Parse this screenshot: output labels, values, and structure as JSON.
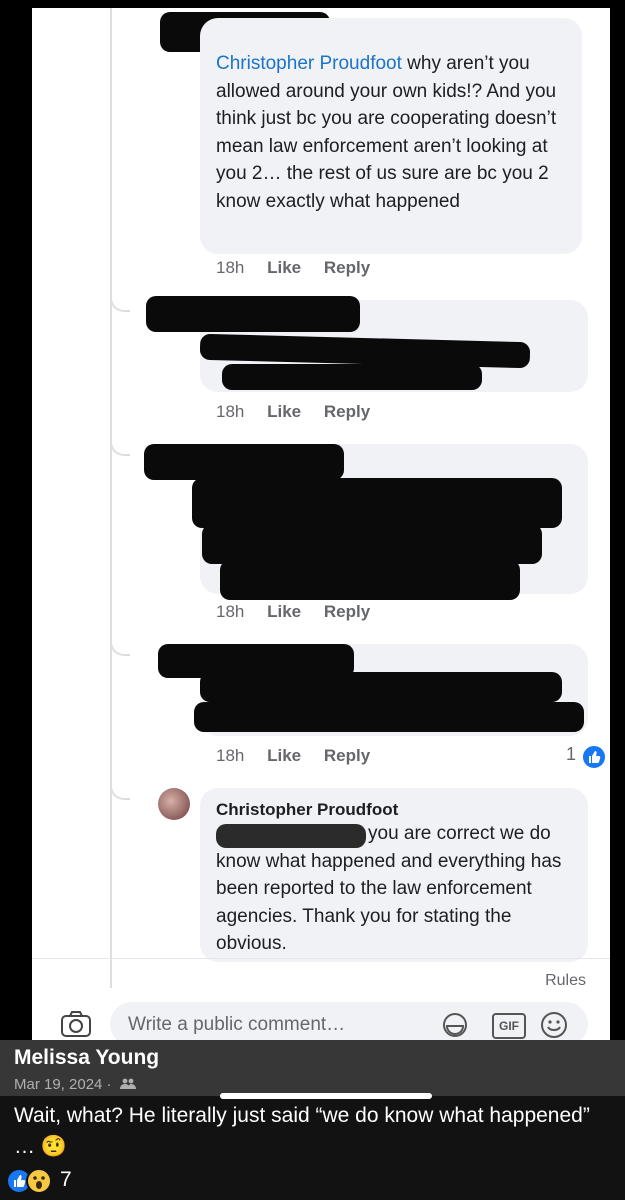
{
  "comments": [
    {
      "name": "Christopher Proudfoot",
      "text": " why aren’t you allowed around your own kids!? And you think just bc you are cooperating doesn’t mean law enforcement aren’t looking at you 2… the rest of us sure are bc you 2 know exactly what happened",
      "time": "18h",
      "like": "Like",
      "reply": "Reply"
    },
    {
      "time": "18h",
      "like": "Like",
      "reply": "Reply"
    },
    {
      "time": "18h",
      "like": "Like",
      "reply": "Reply"
    },
    {
      "time": "18h",
      "like": "Like",
      "reply": "Reply",
      "reaction_count": "1"
    },
    {
      "author": "Christopher Proudfoot",
      "text": " you are correct we do know what happened and everything has been reported to the law enforcement agencies. Thank you for stating the obvious."
    }
  ],
  "rules": "Rules",
  "composer": {
    "placeholder": "Write a public comment…",
    "gif": "GIF"
  },
  "post": {
    "author": "Melissa Young",
    "date": "Mar 19, 2024 ·",
    "text": "Wait, what? He literally just said “we do know what happened” …",
    "emoji": "🤨",
    "reaction_count": "7"
  },
  "colors": {
    "link_blue": "#1b74c9",
    "like_blue": "#1877f2",
    "bubble": "#f0f2f5"
  }
}
